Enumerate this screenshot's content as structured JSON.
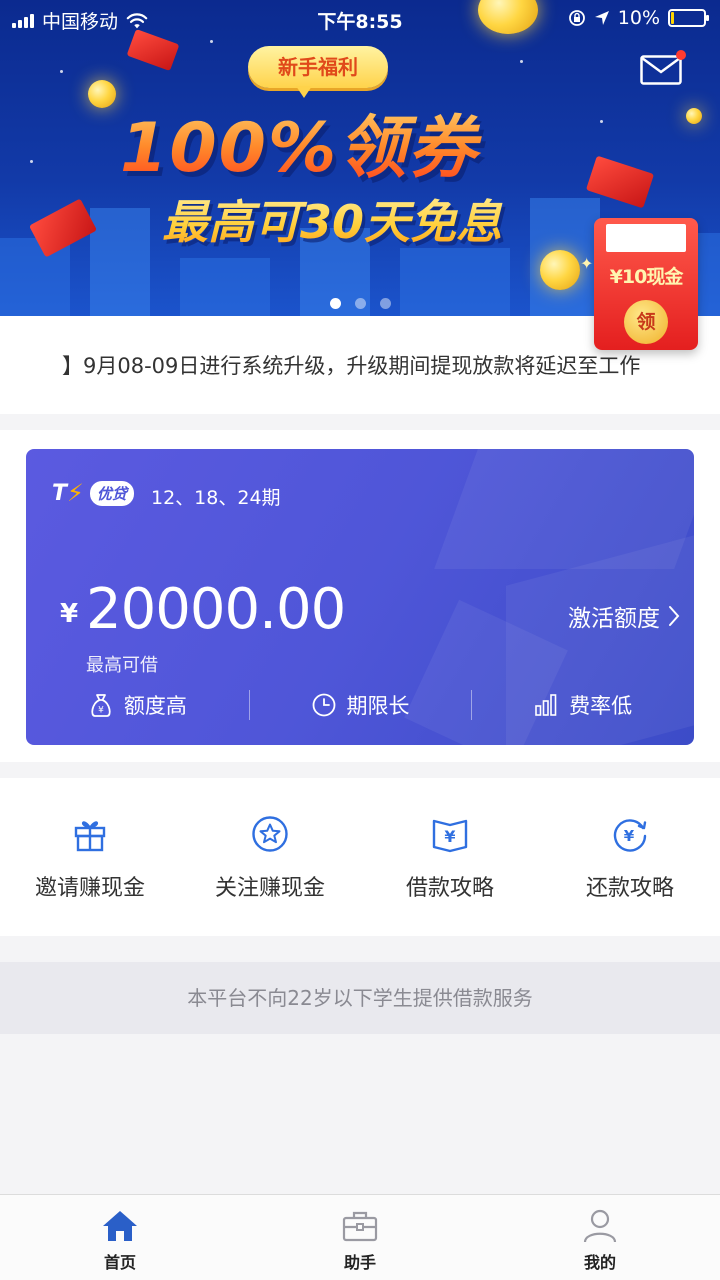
{
  "status_bar": {
    "carrier": "中国移动",
    "time": "下午8:55",
    "battery": "10%"
  },
  "banner": {
    "tag": "新手福利",
    "title": "100%领券",
    "subtitle": "最高可30天免息",
    "slides": 3,
    "active_slide": 1
  },
  "red_packet": {
    "amount": "¥10现金",
    "claim": "领"
  },
  "notice": {
    "text": "】9月08-09日进行系统升级，升级期间提现放款将延迟至工作"
  },
  "loan_card": {
    "brand": "优贷",
    "periods": "12、18、24期",
    "currency": "¥",
    "amount": "20000.00",
    "amount_label": "最高可借",
    "activate_label": "激活额度",
    "features": [
      {
        "icon": "money-bag-icon",
        "label": "额度高"
      },
      {
        "icon": "clock-icon",
        "label": "期限长"
      },
      {
        "icon": "bar-chart-icon",
        "label": "费率低"
      }
    ]
  },
  "actions": [
    {
      "icon": "gift-icon",
      "label": "邀请赚现金"
    },
    {
      "icon": "star-icon",
      "label": "关注赚现金"
    },
    {
      "icon": "book-yen-icon",
      "label": "借款攻略"
    },
    {
      "icon": "yen-refresh-icon",
      "label": "还款攻略"
    }
  ],
  "disclaimer": "本平台不向22岁以下学生提供借款服务",
  "tabbar": [
    {
      "icon": "home-icon",
      "label": "首页",
      "active": true
    },
    {
      "icon": "briefcase-icon",
      "label": "助手",
      "active": false
    },
    {
      "icon": "user-icon",
      "label": "我的",
      "active": false
    }
  ],
  "colors": {
    "accent": "#4f56d8",
    "icon_blue": "#2f6fe0",
    "tab_active": "#2a5fc8",
    "tab_inactive": "#9a9aa2"
  }
}
